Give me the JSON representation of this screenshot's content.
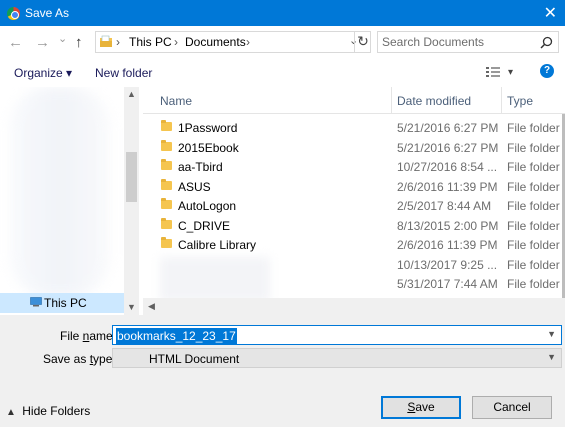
{
  "window": {
    "title": "Save As",
    "close": "✕"
  },
  "nav": {
    "back": "←",
    "forward": "→",
    "recent": "⌄",
    "up": "↑",
    "breadcrumb": [
      "This PC",
      "Documents"
    ],
    "separator": "›",
    "refresh": "↻",
    "search_placeholder": "Search Documents"
  },
  "toolbar": {
    "organize": "Organize ▾",
    "new_folder": "New folder",
    "view_dd": "▾",
    "help": "?"
  },
  "navpane": {
    "this_pc": "This PC"
  },
  "columns": {
    "name": "Name",
    "date": "Date modified",
    "type": "Type"
  },
  "files": [
    {
      "name": "1Password",
      "date": "5/21/2016 6:27 PM",
      "type": "File folder",
      "icon": true
    },
    {
      "name": "2015Ebook",
      "date": "5/21/2016 6:27 PM",
      "type": "File folder",
      "icon": true
    },
    {
      "name": "aa-Tbird",
      "date": "10/27/2016 8:54 ...",
      "type": "File folder",
      "icon": true
    },
    {
      "name": "ASUS",
      "date": "2/6/2016 11:39 PM",
      "type": "File folder",
      "icon": true
    },
    {
      "name": "AutoLogon",
      "date": "2/5/2017 8:44 AM",
      "type": "File folder",
      "icon": true
    },
    {
      "name": "C_DRIVE",
      "date": "8/13/2015 2:00 PM",
      "type": "File folder",
      "icon": true
    },
    {
      "name": "Calibre Library",
      "date": "2/6/2016 11:39 PM",
      "type": "File folder",
      "icon": true
    },
    {
      "name": "",
      "date": "10/13/2017 9:25 ...",
      "type": "File folder",
      "icon": false
    },
    {
      "name": "",
      "date": "5/31/2017 7:44 AM",
      "type": "File folder",
      "icon": false
    }
  ],
  "form": {
    "file_name_label": "File name:",
    "file_name_value": "bookmarks_12_23_17",
    "save_type_label": "Save as type:",
    "save_type_value": "HTML Document"
  },
  "footer": {
    "hide_folders": "Hide Folders",
    "save": "Save",
    "cancel": "Cancel"
  }
}
